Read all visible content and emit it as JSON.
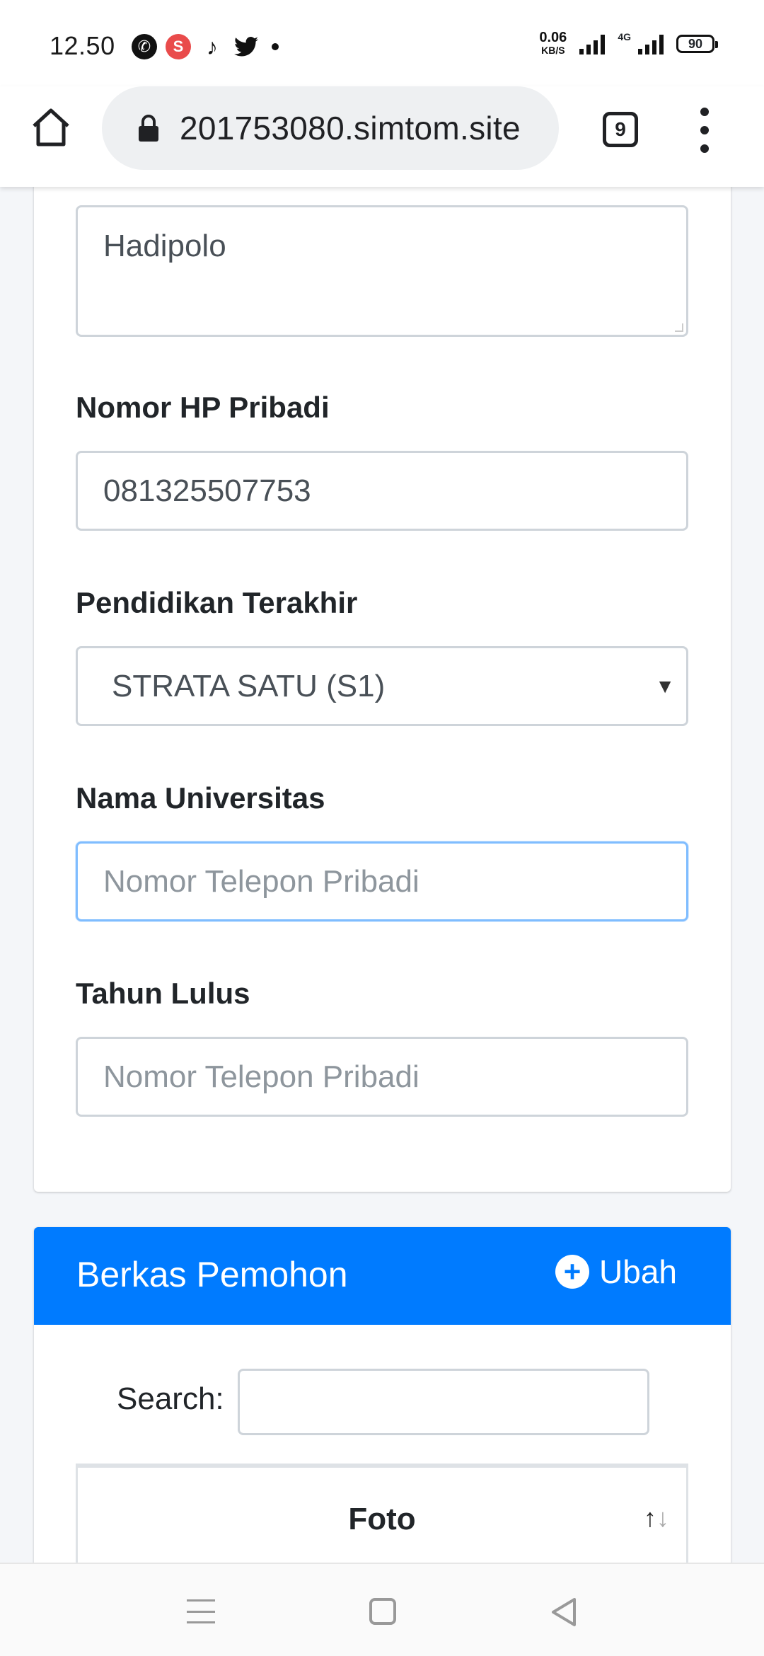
{
  "status_bar": {
    "time": "12.50",
    "notification_icons": [
      "whatsapp-icon",
      "s-app-icon",
      "tiktok-icon",
      "twitter-icon",
      "dot-icon"
    ],
    "net_speed_value": "0.06",
    "net_speed_unit": "KB/S",
    "network_type": "4G",
    "battery": "90"
  },
  "browser": {
    "url": "201753080.simtom.site",
    "tab_count": "9"
  },
  "form": {
    "address_value": "Hadipolo",
    "phone_label": "Nomor HP Pribadi",
    "phone_value": "081325507753",
    "education_label": "Pendidikan Terakhir",
    "education_selected": "STRATA SATU (S1)",
    "university_label": "Nama Universitas",
    "university_placeholder": "Nomor Telepon Pribadi",
    "graduation_label": "Tahun Lulus",
    "graduation_placeholder": "Nomor Telepon Pribadi"
  },
  "files_card": {
    "title": "Berkas Pemohon",
    "edit_button": "Ubah",
    "search_label": "Search:",
    "table_columns": [
      "Foto"
    ]
  },
  "colors": {
    "primary": "#007bff",
    "input_border": "#ced4da",
    "focus_border": "#80bdff",
    "page_background": "#f4f6f9"
  }
}
